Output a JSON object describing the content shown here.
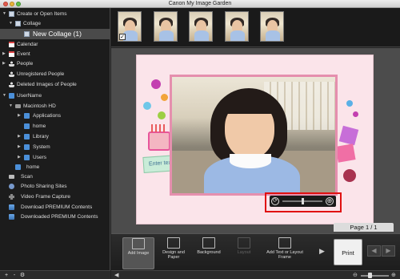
{
  "window": {
    "title": "Canon My Image Garden"
  },
  "sidebar": {
    "items": [
      {
        "label": "Create or Open Items",
        "arrow": "▼",
        "icon": "document-icon"
      },
      {
        "label": "Collage",
        "arrow": "▼",
        "icon": "collage-icon"
      },
      {
        "label": "New Collage (1)",
        "selected": true,
        "icon": "collage-page-icon"
      },
      {
        "label": "Calendar",
        "icon": "calendar-icon"
      },
      {
        "label": "Event",
        "arrow": "▶",
        "icon": "event-icon"
      },
      {
        "label": "People",
        "arrow": "▶",
        "icon": "people-icon"
      },
      {
        "label": "Unregistered People",
        "icon": "person-icon"
      },
      {
        "label": "Deleted Images of People",
        "icon": "person-icon"
      },
      {
        "label": "UserName",
        "arrow": "▼",
        "icon": "home-icon"
      },
      {
        "label": "Macintosh HD",
        "arrow": "▼",
        "icon": "drive-icon"
      },
      {
        "label": "Applications",
        "arrow": "▶",
        "icon": "folder-icon"
      },
      {
        "label": "home",
        "icon": "folder-icon"
      },
      {
        "label": "Library",
        "arrow": "▶",
        "icon": "folder-icon"
      },
      {
        "label": "System",
        "arrow": "▶",
        "icon": "folder-icon"
      },
      {
        "label": "Users",
        "arrow": "▶",
        "icon": "folder-icon"
      },
      {
        "label": "home",
        "icon": "folder-icon"
      },
      {
        "label": "Scan",
        "icon": "scanner-icon"
      },
      {
        "label": "Photo Sharing Sites",
        "icon": "globe-icon"
      },
      {
        "label": "Video Frame Capture",
        "icon": "film-icon"
      },
      {
        "label": "Download PREMIUM Contents",
        "icon": "download-icon"
      },
      {
        "label": "Downloaded PREMIUM Contents",
        "icon": "download-icon"
      }
    ],
    "bottom": {
      "add_label": "+",
      "remove_label": "-",
      "settings_label": "⚙"
    }
  },
  "thumbnails": {
    "count": 5,
    "checked_index": 0,
    "check_mark": "✓"
  },
  "canvas": {
    "text_placeholder": "Enter tex",
    "controls": {
      "rotate_label": "⟳",
      "zoom_label": "⊕",
      "zoom_fraction": 0.5
    },
    "page_indicator": "Page 1 / 1"
  },
  "toolbar": {
    "tools": [
      {
        "label": "Add Image",
        "active": true,
        "icon": "add-image-icon"
      },
      {
        "label": "Design and Paper",
        "icon": "design-paper-icon"
      },
      {
        "label": "Background",
        "icon": "background-icon"
      },
      {
        "label": "Layout",
        "disabled": true,
        "icon": "layout-icon"
      },
      {
        "label": "Add Text or Layout Frame",
        "icon": "add-text-icon"
      }
    ],
    "more_label": "▶",
    "print_label": "Print",
    "prev_label": "◀",
    "next_label": "▶"
  },
  "statusbar": {
    "left_label": "◀",
    "zoom_out_label": "⊖",
    "zoom_in_label": "⊕",
    "zoom_fraction": 0.3
  },
  "colors": {
    "accent_highlight": "#e01010",
    "page_background": "#fbe4ea",
    "photo_frame": "#e58fae",
    "sidebar_background": "#1c1c1c",
    "selected_row": "#4a4a4a"
  }
}
